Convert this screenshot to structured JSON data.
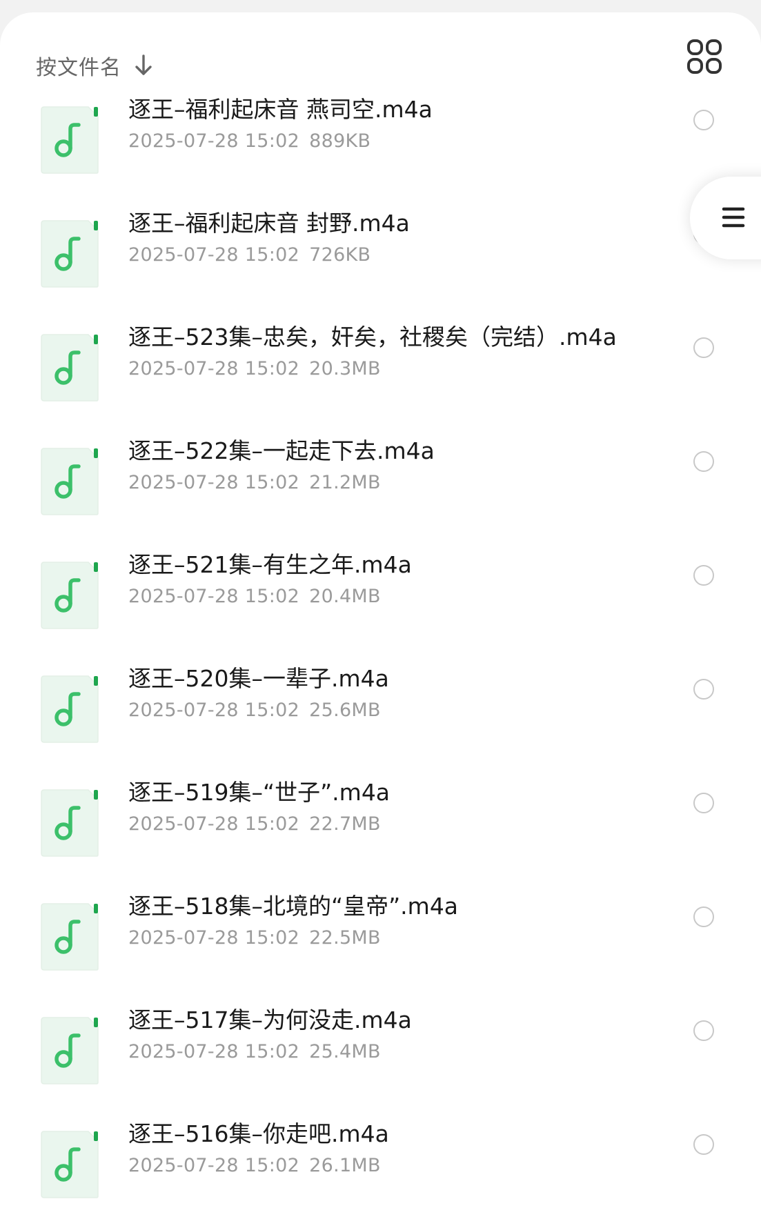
{
  "sort": {
    "label": "按文件名",
    "arrow_icon": "arrow-down-icon"
  },
  "view_toggle": {
    "icon": "grid-view-icon"
  },
  "side_menu": {
    "icon": "menu-icon"
  },
  "colors": {
    "accent": "#3cc06a",
    "icon_bg": "#eaf6ee",
    "icon_corner": "#1ea64e"
  },
  "files": [
    {
      "name": "逐王–福利起床音 燕司空.m4a",
      "date": "2025-07-28 15:02",
      "size": "889KB"
    },
    {
      "name": "逐王–福利起床音 封野.m4a",
      "date": "2025-07-28 15:02",
      "size": "726KB"
    },
    {
      "name": "逐王–523集–忠矣，奸矣，社稷矣（完结）.m4a",
      "date": "2025-07-28 15:02",
      "size": "20.3MB"
    },
    {
      "name": "逐王–522集–一起走下去.m4a",
      "date": "2025-07-28 15:02",
      "size": "21.2MB"
    },
    {
      "name": "逐王–521集–有生之年.m4a",
      "date": "2025-07-28 15:02",
      "size": "20.4MB"
    },
    {
      "name": "逐王–520集–一辈子.m4a",
      "date": "2025-07-28 15:02",
      "size": "25.6MB"
    },
    {
      "name": "逐王–519集–“世子”.m4a",
      "date": "2025-07-28 15:02",
      "size": "22.7MB"
    },
    {
      "name": "逐王–518集–北境的“皇帝”.m4a",
      "date": "2025-07-28 15:02",
      "size": "22.5MB"
    },
    {
      "name": "逐王–517集–为何没走.m4a",
      "date": "2025-07-28 15:02",
      "size": "25.4MB"
    },
    {
      "name": "逐王–516集–你走吧.m4a",
      "date": "2025-07-28 15:02",
      "size": "26.1MB"
    }
  ]
}
